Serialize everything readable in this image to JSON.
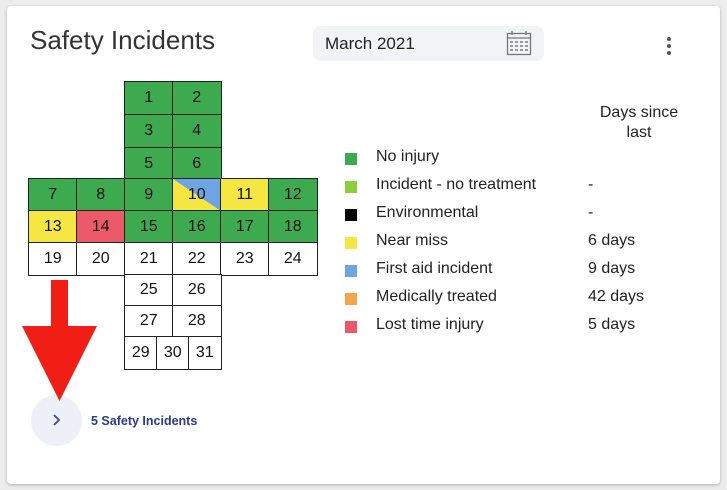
{
  "card": {
    "title": "Safety Incidents",
    "date": "March 2021",
    "icons": {
      "calendar": "calendar-icon",
      "more": "more-vert-icon",
      "expand": "chevron-right-icon",
      "annotation": "red-down-arrow"
    }
  },
  "calendar": {
    "days": [
      {
        "day": "1",
        "status": "green"
      },
      {
        "day": "2",
        "status": "green"
      },
      {
        "day": "3",
        "status": "green"
      },
      {
        "day": "4",
        "status": "green"
      },
      {
        "day": "5",
        "status": "green"
      },
      {
        "day": "6",
        "status": "green"
      },
      {
        "day": "7",
        "status": "green"
      },
      {
        "day": "8",
        "status": "green"
      },
      {
        "day": "9",
        "status": "green"
      },
      {
        "day": "10",
        "status": "split-blue-yellow"
      },
      {
        "day": "11",
        "status": "yellow"
      },
      {
        "day": "12",
        "status": "green"
      },
      {
        "day": "13",
        "status": "yellow"
      },
      {
        "day": "14",
        "status": "red"
      },
      {
        "day": "15",
        "status": "green"
      },
      {
        "day": "16",
        "status": "green"
      },
      {
        "day": "17",
        "status": "green"
      },
      {
        "day": "18",
        "status": "green"
      },
      {
        "day": "19",
        "status": "none"
      },
      {
        "day": "20",
        "status": "none"
      },
      {
        "day": "21",
        "status": "none"
      },
      {
        "day": "22",
        "status": "none"
      },
      {
        "day": "23",
        "status": "none"
      },
      {
        "day": "24",
        "status": "none"
      },
      {
        "day": "25",
        "status": "none"
      },
      {
        "day": "26",
        "status": "none"
      },
      {
        "day": "27",
        "status": "none"
      },
      {
        "day": "28",
        "status": "none"
      },
      {
        "day": "29",
        "status": "none"
      },
      {
        "day": "30",
        "status": "none"
      },
      {
        "day": "31",
        "status": "none"
      }
    ]
  },
  "legend": {
    "header": "Days since last",
    "items": [
      {
        "label": "No injury",
        "days": "",
        "color": "#3daa4f"
      },
      {
        "label": "Incident - no treatment",
        "days": "-",
        "color": "#8bd03c"
      },
      {
        "label": "Environmental",
        "days": "-",
        "color": "#000000"
      },
      {
        "label": "Near miss",
        "days": "6 days",
        "color": "#f5e642"
      },
      {
        "label": "First aid incident",
        "days": "9 days",
        "color": "#6fa4e3"
      },
      {
        "label": "Medically treated",
        "days": "42 days",
        "color": "#f4a64a"
      },
      {
        "label": "Lost time injury",
        "days": "5 days",
        "color": "#ec5a6a"
      }
    ]
  },
  "footer": {
    "incidents_label": "5 Safety Incidents"
  }
}
